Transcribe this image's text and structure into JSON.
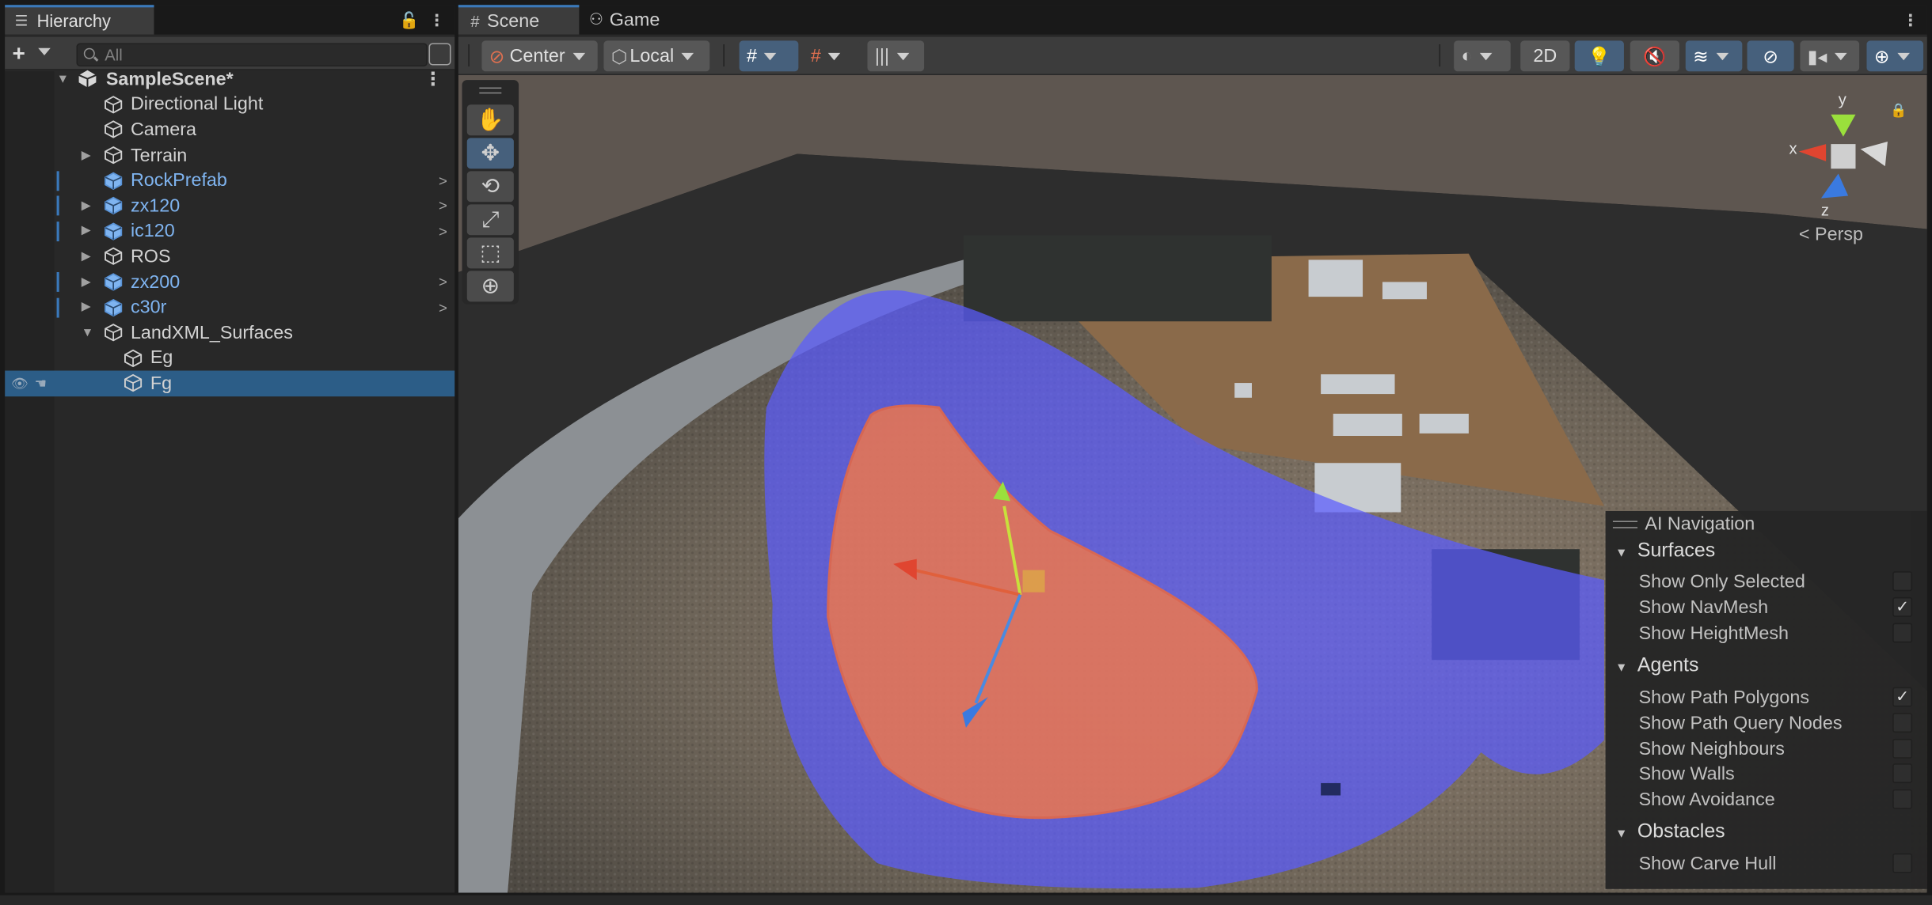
{
  "hierarchy": {
    "tab_title": "Hierarchy",
    "search_placeholder": "All",
    "items": [
      {
        "label": "SampleScene*"
      },
      {
        "label": "Directional Light"
      },
      {
        "label": "Camera"
      },
      {
        "label": "Terrain"
      },
      {
        "label": "RockPrefab"
      },
      {
        "label": "zx120"
      },
      {
        "label": "ic120"
      },
      {
        "label": "ROS"
      },
      {
        "label": "zx200"
      },
      {
        "label": "c30r"
      },
      {
        "label": "LandXML_Surfaces"
      },
      {
        "label": "Eg"
      },
      {
        "label": "Fg"
      }
    ]
  },
  "scene": {
    "tab_scene": "Scene",
    "tab_game": "Game",
    "pivot_label": "Center",
    "space_label": "Local",
    "mode_2d": "2D",
    "projection_label": "Persp",
    "axis_x": "x",
    "axis_y": "y",
    "axis_z": "z"
  },
  "ai_navigation": {
    "title": "AI Navigation",
    "surfaces": {
      "title": "Surfaces",
      "show_only_selected": "Show Only Selected",
      "show_navmesh": "Show NavMesh",
      "show_heightmesh": "Show HeightMesh"
    },
    "agents": {
      "title": "Agents",
      "show_path_polygons": "Show Path Polygons",
      "show_path_query_nodes": "Show Path Query Nodes",
      "show_neighbours": "Show Neighbours",
      "show_walls": "Show Walls",
      "show_avoidance": "Show Avoidance"
    },
    "obstacles": {
      "title": "Obstacles",
      "show_carve_hull": "Show Carve Hull"
    },
    "check_mark": "✓"
  },
  "colors": {
    "selection": "#2c5d87",
    "prefab_text": "#7fb4f0",
    "accent": "#3a79bb",
    "navmesh_blue": "#5a5cff",
    "surface_orange": "#ff7a3c"
  }
}
